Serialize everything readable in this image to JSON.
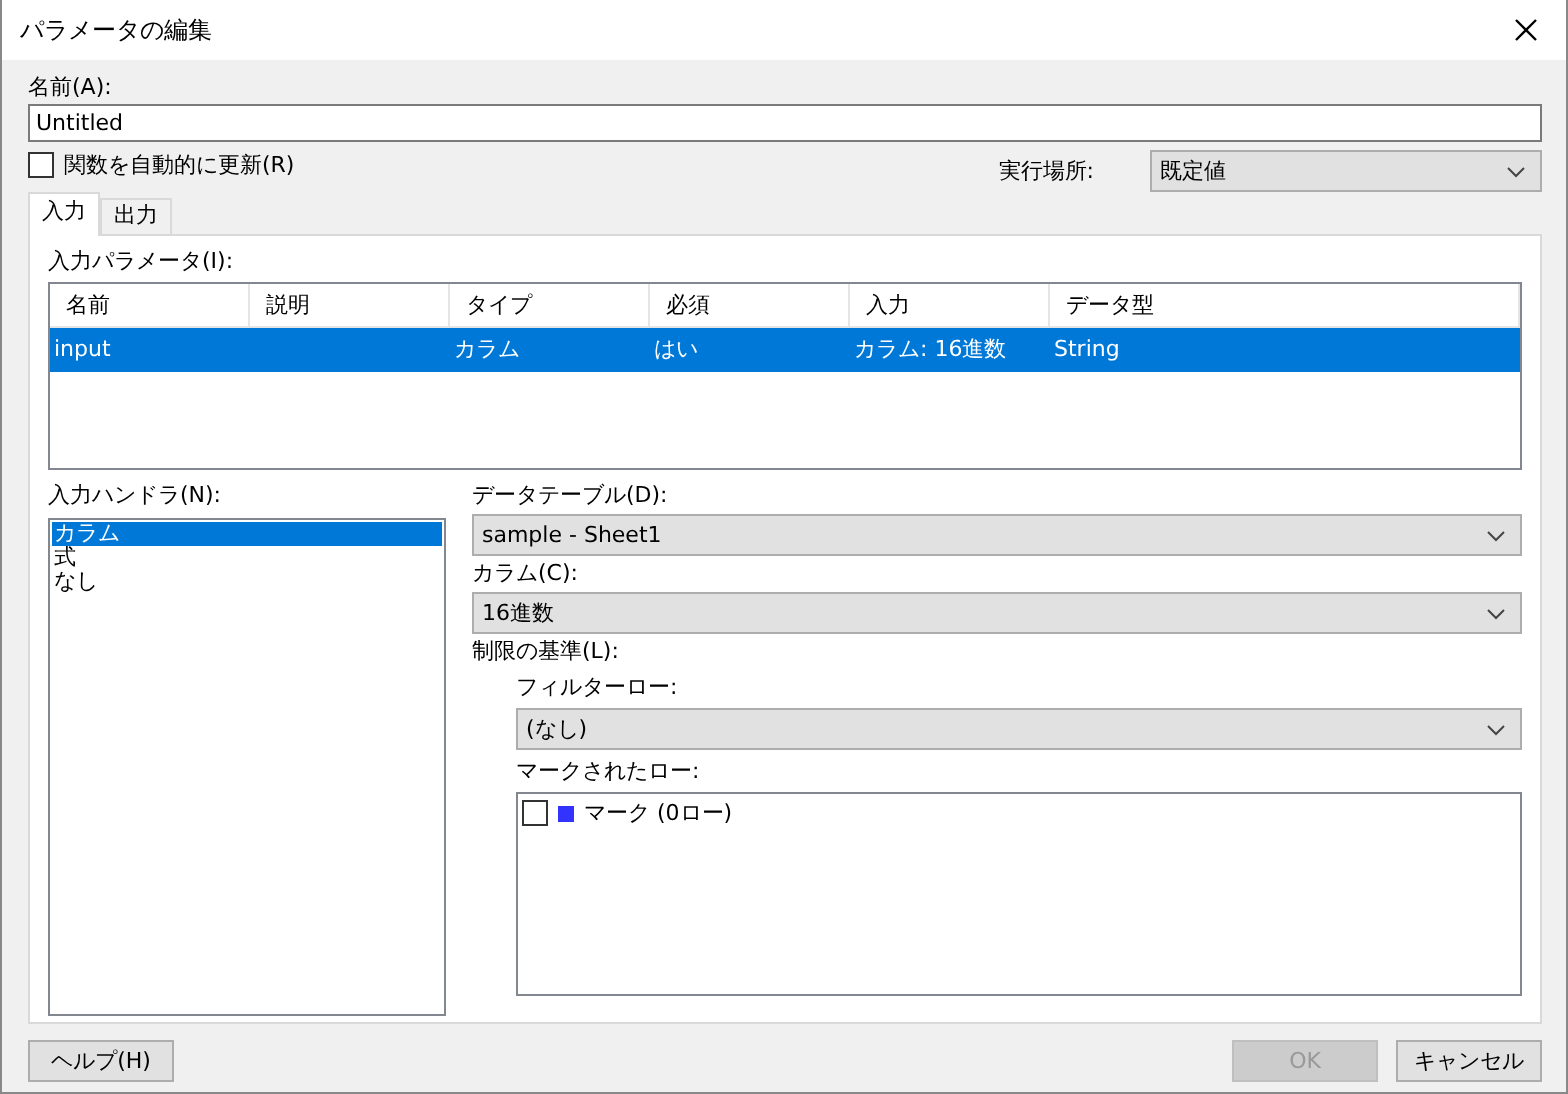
{
  "window": {
    "title": "パラメータの編集"
  },
  "name_field": {
    "label": "名前(A):",
    "value": "Untitled"
  },
  "auto_update": {
    "label": "関数を自動的に更新(R)",
    "checked": false
  },
  "run_location": {
    "label": "実行場所:",
    "value": "既定値"
  },
  "tabs": [
    {
      "label": "入力",
      "selected": true
    },
    {
      "label": "出力",
      "selected": false
    }
  ],
  "input_parameters": {
    "label": "入力パラメータ(I):",
    "columns": [
      "名前",
      "説明",
      "タイプ",
      "必須",
      "入力",
      "データ型"
    ],
    "rows": [
      {
        "cells": [
          "input",
          null,
          "カラム",
          "はい",
          "カラム: 16進数",
          "String"
        ],
        "selected": true
      }
    ]
  },
  "input_handlers": {
    "label": "入力ハンドラ(N):",
    "items": [
      {
        "label": "カラム",
        "selected": true
      },
      {
        "label": "式",
        "selected": false
      },
      {
        "label": "なし",
        "selected": false
      }
    ]
  },
  "data_table": {
    "label": "データテーブル(D):",
    "value": "sample - Sheet1"
  },
  "column": {
    "label": "カラム(C):",
    "value": "16進数"
  },
  "limit": {
    "label": "制限の基準(L):",
    "filter_rows": {
      "label": "フィルターロー:",
      "value": "(なし)"
    },
    "marked_rows": {
      "label": "マークされたロー:",
      "items": [
        {
          "label": "マーク (0ロー)",
          "checked": false,
          "color": "#3333ff"
        }
      ]
    }
  },
  "buttons": [
    {
      "label": "ヘルプ(H)",
      "disabled": false
    },
    {
      "label": "OK",
      "disabled": true
    },
    {
      "label": "キャンセル",
      "disabled": false
    }
  ]
}
